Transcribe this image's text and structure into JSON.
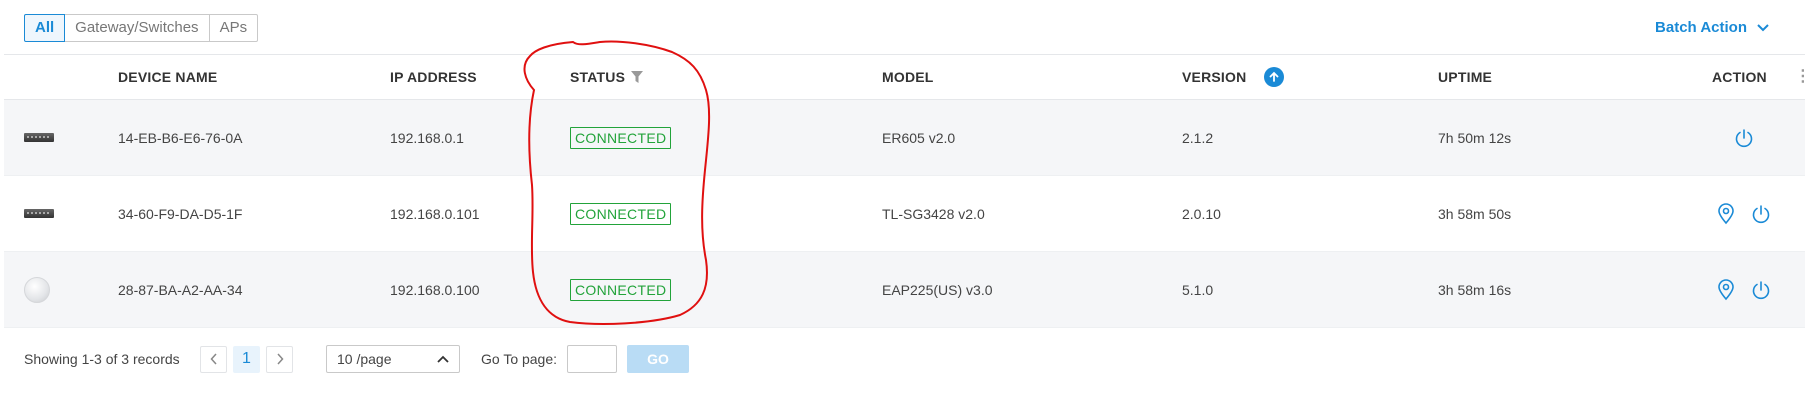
{
  "filters": {
    "tabs": [
      "All",
      "Gateway/Switches",
      "APs"
    ],
    "active_index": 0
  },
  "batch_action": {
    "label": "Batch Action",
    "icon": "chevron-down-icon"
  },
  "table": {
    "columns": {
      "device_name": "DEVICE NAME",
      "ip_address": "IP ADDRESS",
      "status": "STATUS",
      "model": "MODEL",
      "version": "VERSION",
      "uptime": "UPTIME",
      "action": "ACTION"
    },
    "rows": [
      {
        "device_type": "router-icon",
        "name": "14-EB-B6-E6-76-0A",
        "ip": "192.168.0.1",
        "status": "CONNECTED",
        "model": "ER605 v2.0",
        "version": "2.1.2",
        "uptime": "7h 50m 12s",
        "actions": [
          "power-icon"
        ]
      },
      {
        "device_type": "switch-icon",
        "name": "34-60-F9-DA-D5-1F",
        "ip": "192.168.0.101",
        "status": "CONNECTED",
        "model": "TL-SG3428 v2.0",
        "version": "2.0.10",
        "uptime": "3h 58m 50s",
        "actions": [
          "locate-icon",
          "power-icon"
        ]
      },
      {
        "device_type": "access-point-icon",
        "name": "28-87-BA-A2-AA-34",
        "ip": "192.168.0.100",
        "status": "CONNECTED",
        "model": "EAP225(US) v3.0",
        "version": "5.1.0",
        "uptime": "3h 58m 16s",
        "actions": [
          "locate-icon",
          "power-icon"
        ]
      }
    ]
  },
  "footer": {
    "showing": "Showing 1-3 of 3 records",
    "current_page": "1",
    "page_size": "10 /page",
    "goto_label": "Go To page:",
    "goto_value": "",
    "go_label": "GO"
  },
  "colors": {
    "accent": "#1a8ad6",
    "connected": "#22a33a",
    "annotation": "#e01010"
  }
}
